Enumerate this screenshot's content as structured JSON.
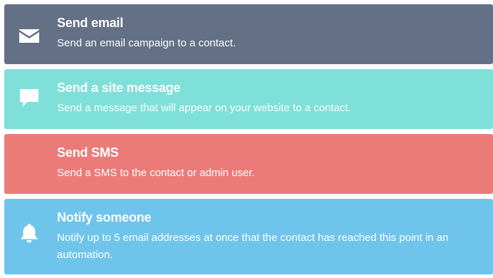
{
  "actions": [
    {
      "title": "Send email",
      "description": "Send an email campaign to a contact.",
      "icon": "envelope-icon",
      "color": "#637085"
    },
    {
      "title": "Send a site message",
      "description": "Send a message that will appear on your website to a contact.",
      "icon": "speech-bubble-icon",
      "color": "#7fe0d9"
    },
    {
      "title": "Send SMS",
      "description": "Send a SMS to the contact or admin user.",
      "icon": "",
      "color": "#eb7b79"
    },
    {
      "title": "Notify someone",
      "description": "Notify up to 5 email addresses at once that the contact has reached this point in an automation.",
      "icon": "bell-icon",
      "color": "#6fc4ec"
    }
  ]
}
